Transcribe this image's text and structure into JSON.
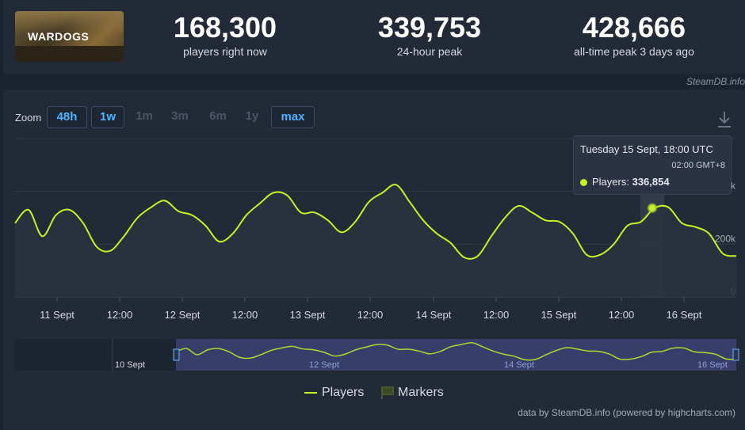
{
  "game": {
    "logo_text": "WARDOGS"
  },
  "stats": [
    {
      "value": "168,300",
      "label": "players right now"
    },
    {
      "value": "339,753",
      "label": "24-hour peak"
    },
    {
      "value": "428,666",
      "label": "all-time peak 3 days ago"
    }
  ],
  "credit": "SteamDB.info",
  "zoom": {
    "label": "Zoom",
    "buttons": [
      {
        "label": "48h",
        "active": true
      },
      {
        "label": "1w",
        "active": true
      },
      {
        "label": "1m",
        "active": false
      },
      {
        "label": "3m",
        "active": false
      },
      {
        "label": "6m",
        "active": false
      },
      {
        "label": "1y",
        "active": false
      },
      {
        "label": "max",
        "active": true
      }
    ]
  },
  "tooltip": {
    "title": "Tuesday 15 Sept, 18:00 UTC",
    "local_time": "02:00 GMT+8",
    "series_label": "Players:",
    "series_value": "336,854"
  },
  "legend": {
    "players": "Players",
    "markers": "Markers"
  },
  "footer": "data by SteamDB.info (powered by highcharts.com)",
  "navigator": {
    "labels": [
      "10 Sept",
      "12 Sept",
      "14 Sept",
      "16 Sept"
    ]
  },
  "colors": {
    "series": "#c6f124",
    "accent": "#4fb3ff",
    "background": "#1b2230"
  },
  "chart_data": {
    "type": "area",
    "ytick_labels": [
      "0",
      "200k",
      "400k"
    ],
    "ylim": [
      0,
      600000
    ],
    "xtick_labels": [
      "11 Sept",
      "12:00",
      "12 Sept",
      "12:00",
      "13 Sept",
      "12:00",
      "14 Sept",
      "12:00",
      "15 Sept",
      "12:00",
      "16 Sept"
    ],
    "x_hours": [
      0,
      2,
      4,
      6,
      8,
      10,
      12,
      14,
      16,
      18,
      20,
      22,
      24,
      26,
      28,
      30,
      32,
      34,
      36,
      38,
      40,
      42,
      44,
      46,
      48,
      50,
      52,
      54,
      56,
      58,
      60,
      62,
      64,
      66,
      68,
      70,
      72,
      74,
      76,
      78,
      80,
      82,
      84,
      86,
      88,
      90,
      92,
      94,
      96,
      98,
      100,
      102,
      104,
      106,
      108,
      110,
      112,
      114,
      116,
      118,
      120,
      122,
      124,
      126,
      128,
      130,
      132,
      134,
      136,
      138,
      140,
      142,
      144,
      146
    ],
    "series": [
      {
        "name": "Players",
        "values": [
          280000,
          330000,
          230000,
          310000,
          330000,
          280000,
          190000,
          175000,
          230000,
          300000,
          340000,
          365000,
          325000,
          310000,
          270000,
          210000,
          240000,
          310000,
          355000,
          395000,
          385000,
          320000,
          320000,
          290000,
          245000,
          285000,
          360000,
          395000,
          425000,
          360000,
          290000,
          240000,
          205000,
          150000,
          155000,
          230000,
          300000,
          345000,
          320000,
          290000,
          285000,
          240000,
          160000,
          160000,
          200000,
          270000,
          285000,
          337000,
          340000,
          280000,
          265000,
          240000,
          165000,
          155000
        ],
        "note": "values sampled every ~2.7 h across the visible window"
      }
    ],
    "highlight": {
      "label": "Tuesday 15 Sept, 18:00 UTC",
      "value": 336854
    }
  }
}
